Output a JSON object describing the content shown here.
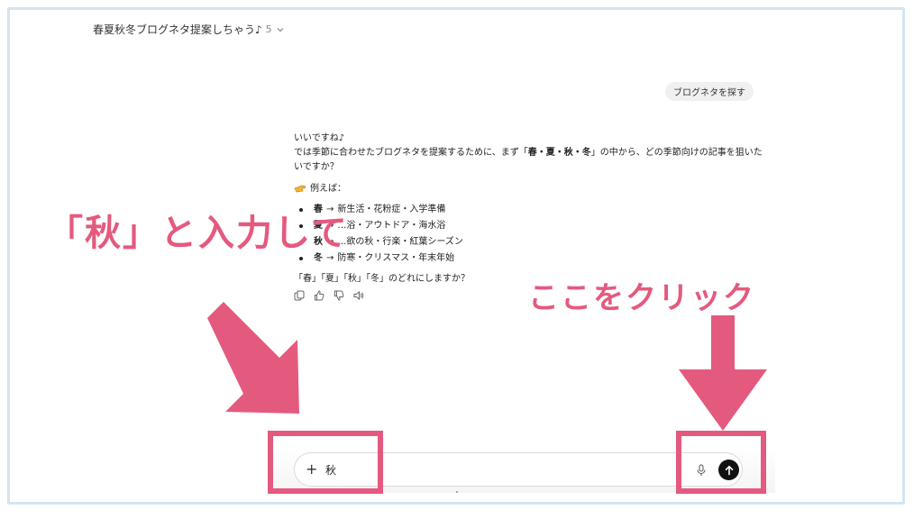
{
  "conversation": {
    "title": "春夏秋冬ブログネタ提案しちゃう♪",
    "version": "5"
  },
  "user_message": "ブログネタを探す",
  "assistant": {
    "line1": "いいですね♪",
    "line2_prefix": "では季節に合わせたブログネタを提案するために、まず「",
    "line2_bold": "春・夏・秋・冬",
    "line2_suffix": "」の中から、どの季節向けの記事を狙いたいですか？",
    "examples_label": "例えば：",
    "items": [
      {
        "season": "春",
        "arrow": "→",
        "text": "新生活・花粉症・入学準備"
      },
      {
        "season": "夏",
        "arrow": "→",
        "text": "…浴・アウトドア・海水浴"
      },
      {
        "season": "秋",
        "arrow": "→",
        "text": "…欲の秋・行楽・紅葉シーズン"
      },
      {
        "season": "冬",
        "arrow": "→",
        "text": "防寒・クリスマス・年末年始"
      }
    ],
    "question": "「春」「夏」「秋」「冬」のどれにしますか？"
  },
  "composer": {
    "plus_label": "+",
    "input_value": "秋"
  },
  "annotations": {
    "left_text": "「秋」と入力して",
    "right_text": "ここをクリック"
  },
  "colors": {
    "accent_pink": "#e45a7e",
    "frame_border": "#d2e6f0",
    "send_button": "#111111"
  },
  "icons": [
    "chevron-down-icon",
    "pointing-hand-icon",
    "copy-icon",
    "thumbs-up-icon",
    "thumbs-down-icon",
    "speaker-icon",
    "plus-icon",
    "microphone-icon",
    "arrow-up-icon"
  ]
}
